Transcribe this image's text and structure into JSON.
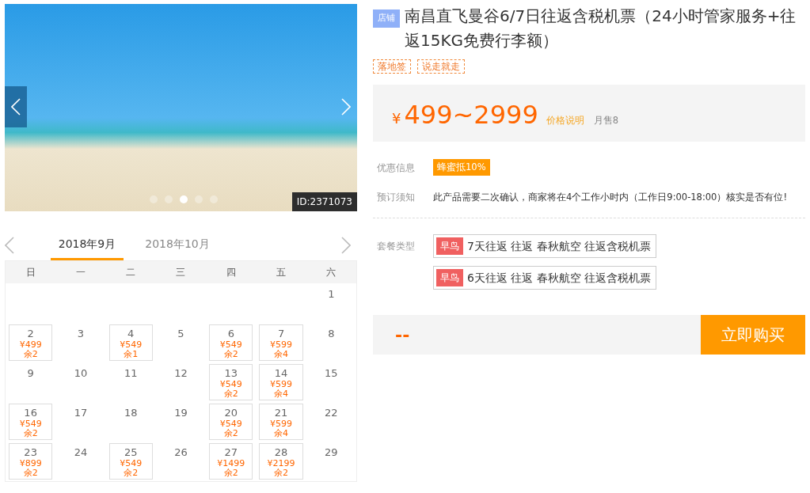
{
  "gallery": {
    "photo_id": "ID:2371073",
    "dots": [
      {
        "selected": false
      },
      {
        "selected": false
      },
      {
        "selected": true
      },
      {
        "selected": false
      },
      {
        "selected": false
      }
    ]
  },
  "calendar": {
    "months": [
      {
        "label": "2018年9月",
        "selected": true
      },
      {
        "label": "2018年10月",
        "selected": false
      }
    ],
    "weekdays": [
      "日",
      "一",
      "二",
      "三",
      "四",
      "五",
      "六"
    ],
    "weeks": [
      {
        "starts_mid_week": true,
        "days": [
          {
            "day": "1"
          }
        ]
      },
      {
        "days": [
          {
            "day": "2",
            "price": "¥499",
            "stock": "余2"
          },
          {
            "day": "3"
          },
          {
            "day": "4",
            "price": "¥549",
            "stock": "余1"
          },
          {
            "day": "5"
          },
          {
            "day": "6",
            "price": "¥549",
            "stock": "余2"
          },
          {
            "day": "7",
            "price": "¥599",
            "stock": "余4"
          },
          {
            "day": "8"
          }
        ]
      },
      {
        "days": [
          {
            "day": "9"
          },
          {
            "day": "10"
          },
          {
            "day": "11"
          },
          {
            "day": "12"
          },
          {
            "day": "13",
            "price": "¥549",
            "stock": "余2"
          },
          {
            "day": "14",
            "price": "¥599",
            "stock": "余4"
          },
          {
            "day": "15"
          }
        ]
      },
      {
        "days": [
          {
            "day": "16",
            "price": "¥549",
            "stock": "余2"
          },
          {
            "day": "17"
          },
          {
            "day": "18"
          },
          {
            "day": "19"
          },
          {
            "day": "20",
            "price": "¥549",
            "stock": "余2"
          },
          {
            "day": "21",
            "price": "¥599",
            "stock": "余4"
          },
          {
            "day": "22"
          }
        ]
      },
      {
        "days": [
          {
            "day": "23",
            "price": "¥899",
            "stock": "余2"
          },
          {
            "day": "24"
          },
          {
            "day": "25",
            "price": "¥549",
            "stock": "余2"
          },
          {
            "day": "26"
          },
          {
            "day": "27",
            "price": "¥1499",
            "stock": "余2"
          },
          {
            "day": "28",
            "price": "¥2199",
            "stock": "余2"
          },
          {
            "day": "29"
          }
        ]
      }
    ]
  },
  "product": {
    "store_badge": "店铺",
    "title": "南昌直飞曼谷6/7日往返含税机票（24小时管家服务+往返15KG免费行李额）",
    "tags": [
      "落地签",
      "说走就走"
    ],
    "price": {
      "currency": "¥",
      "range": "499~2999",
      "note_link": "价格说明",
      "monthly_sales": "月售8"
    },
    "details": [
      {
        "label": "优惠信息",
        "kind": "badge",
        "value": "蜂蜜抵10%"
      },
      {
        "label": "预订须知",
        "kind": "text",
        "value": "此产品需要二次确认，商家将在4个工作小时内（工作日9:00-18:00）核实是否有位!"
      }
    ],
    "package": {
      "label": "套餐类型",
      "options": [
        {
          "tag": "早鸟",
          "text": "7天往返 往返 春秋航空 往返含税机票",
          "selected": false
        },
        {
          "tag": "早鸟",
          "text": "6天往返 往返 春秋航空 往返含税机票",
          "selected": false
        }
      ]
    },
    "total": "--",
    "buy_button": "立即购买"
  }
}
